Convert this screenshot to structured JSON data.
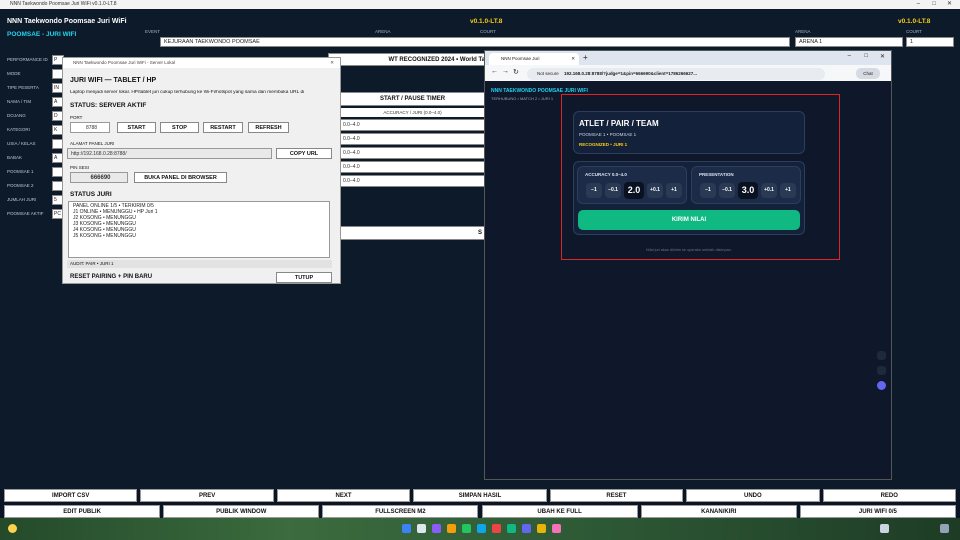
{
  "window": {
    "title": "NNN Taekwondo Poomsae Juri WiFi v0.1.0-LT.8"
  },
  "header": {
    "app_title": "NNN Taekwondo Poomsae Juri WiFi",
    "subtitle": "POOMSAE - JURI WIFI",
    "version_left": "v0.1.0-LT.8",
    "version_right": "v0.1.0-LT.8"
  },
  "fields": {
    "event_label": "EVENT",
    "arena_label": "ARENA",
    "court_label": "COURT",
    "arena2_label": "ARENA",
    "court2_label": "COURT",
    "event_value": "KEJURAAN TAEKWONDO POOMSAE",
    "arena_value": "ARENA 1",
    "court_value": "1"
  },
  "sidebar": [
    "PERFORMANCE ID",
    "MODE",
    "TIPE PESERTA",
    "NAMA / TIM",
    "DOJANG",
    "KATEGORI",
    "USIA / KELAS",
    "BABAK",
    "POOMSAE 1",
    "POOMSAE 2",
    "JUMLAH JURI",
    "POOMSAE AKTIF"
  ],
  "sidebar_values": [
    "P",
    "",
    "IN",
    "A",
    "D",
    "K",
    "",
    "A",
    "",
    "",
    "5",
    "PC"
  ],
  "scoreboard": {
    "banner": "WT RECOGNIZED 2024 • World Ta",
    "start_button": "START / PAUSE TIMER",
    "accuracy_header": "ACCURACY / JURI (0.0–4.0)",
    "rows": [
      "0.0–4.0",
      "0.0–4.0",
      "0.0–4.0",
      "0.0–4.0",
      "0.0–4.0"
    ],
    "s_label": "S"
  },
  "bottom_row1": [
    "IMPORT CSV",
    "PREV",
    "NEXT",
    "SIMPAN HASIL",
    "RESET",
    "UNDO",
    "REDO"
  ],
  "bottom_row2": [
    "EDIT PUBLIK",
    "PUBLIK WINDOW",
    "FULLSCREEN M2",
    "UBAH KE FULL",
    "KANAN/KIRI",
    "JURI WIFI 0/5"
  ],
  "dialog": {
    "titlebar": "NNN Taekwondo Poomsae Juri WiFi - Server Lokal",
    "heading": "JURI WIFI — TABLET / HP",
    "description": "Laptop menjadi server lokal. HP/tablet juri cukup terhubung ke Wi-Fi/hotspot yang sama dan membuka URL di",
    "status": "STATUS: SERVER AKTIF",
    "port_label": "PORT",
    "port_value": "8788",
    "start": "START",
    "stop": "STOP",
    "restart": "RESTART",
    "refresh": "REFRESH",
    "url_label": "ALAMAT PANEL JURI",
    "url_value": "http://192.168.0.28:8788/",
    "copy_url": "COPY URL",
    "pin_label": "PIN SESI",
    "pin_value": "666690",
    "open_browser": "BUKA PANEL DI BROWSER",
    "status_heading": "STATUS JURI",
    "status_lines": [
      "PANEL ONLINE 1/5  •  TERKIRIM 0/5",
      "J1  ONLINE  •  MENUNGGU  •  HP Juri 1",
      "J2  KOSONG  •  MENUNGGU",
      "J3  KOSONG  •  MENUNGGU",
      "J4  KOSONG  •  MENUNGGU",
      "J5  KOSONG  •  MENUNGGU"
    ],
    "audit": "AUDIT: PAIR • JURI 1",
    "reset_pairing": "RESET PAIRING + PIN BARU",
    "close": "TUTUP"
  },
  "browser": {
    "tab_title": "NNN Poomsae Juri",
    "address_prefix": "Not secure",
    "address": "192.168.0.28:8788/?judge=1&pin=666690&client=1786266627...",
    "chat": "Chat",
    "app_header": "NNN TAEKWONDO POOMSAE JURI WIFI",
    "breadcrumb": "TERHUBUNG • MATCH 2 • JURI 1",
    "athlete_title": "ATLET / PAIR / TEAM",
    "athlete_sub": "POOMSAE 1 • POOMSAE 1",
    "recognized": "RECOGNIZED • JURI 1",
    "accuracy_label": "ACCURACY 0.0–4.0",
    "presentation_label": "PRESENTATION",
    "accuracy_value": "2.0",
    "presentation_value": "3.0",
    "minus1": "−1",
    "minus01": "−0.1",
    "plus01": "+0.1",
    "plus1": "+1",
    "submit": "KIRIM NILAI",
    "footnote": "Nilai juri akan dikirim ke operator setelah disimpan."
  },
  "taskbar": {
    "time": "",
    "date": ""
  }
}
